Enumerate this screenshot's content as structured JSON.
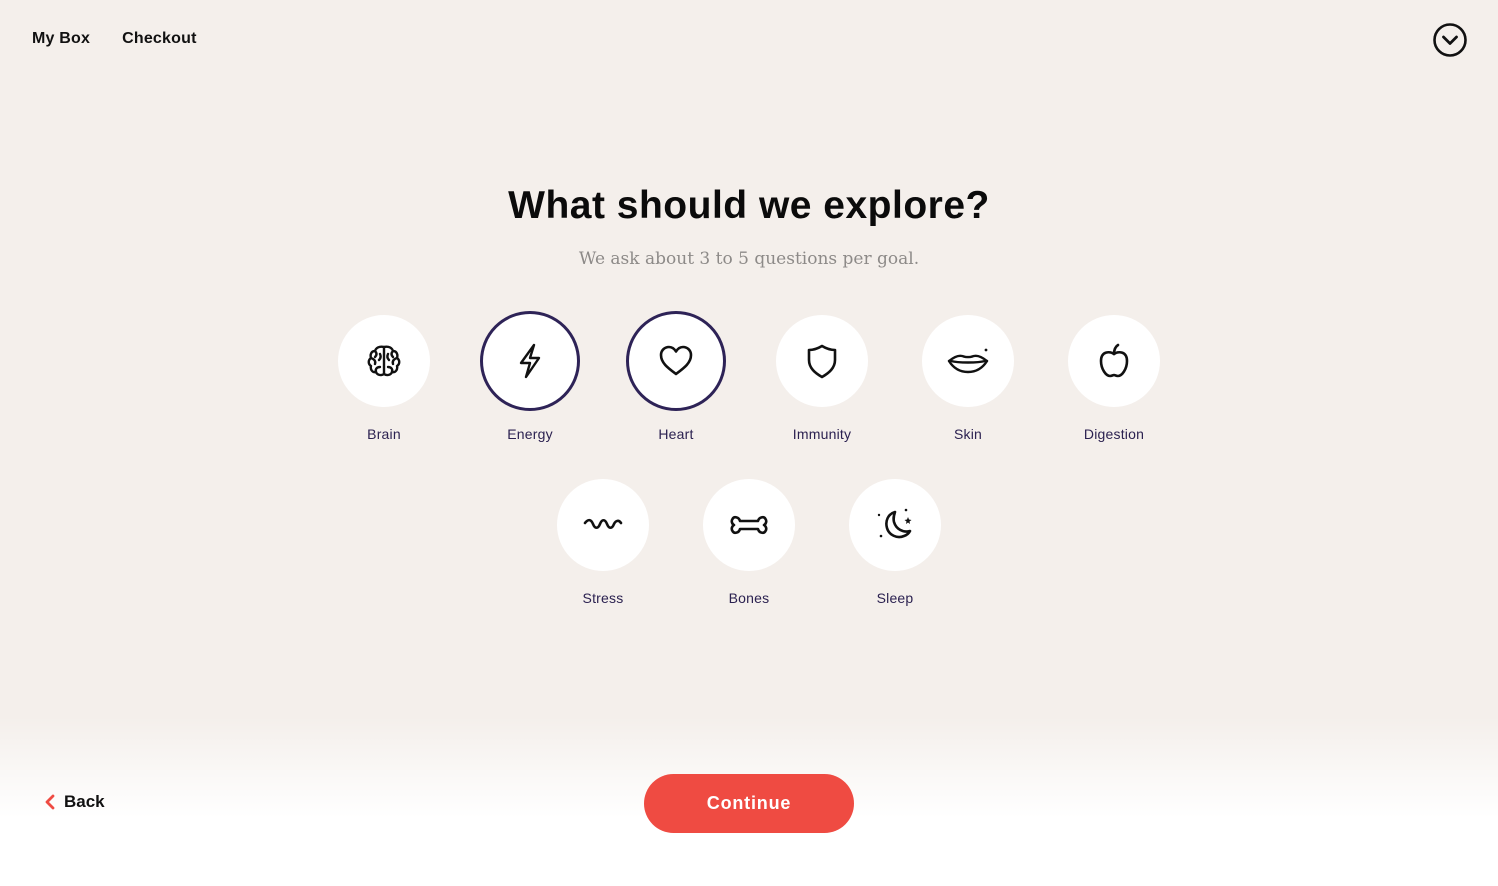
{
  "nav": {
    "items": [
      {
        "label": "My Box"
      },
      {
        "label": "Checkout"
      }
    ],
    "menu_icon": "chevron-down-circle-icon"
  },
  "main": {
    "title": "What should we explore?",
    "subtitle": "We ask about 3 to 5 questions per goal."
  },
  "goals": [
    {
      "label": "Brain",
      "icon": "brain-icon",
      "selected": false
    },
    {
      "label": "Energy",
      "icon": "lightning-icon",
      "selected": true
    },
    {
      "label": "Heart",
      "icon": "heart-icon",
      "selected": true
    },
    {
      "label": "Immunity",
      "icon": "shield-icon",
      "selected": false
    },
    {
      "label": "Skin",
      "icon": "lips-icon",
      "selected": false
    },
    {
      "label": "Digestion",
      "icon": "apple-icon",
      "selected": false
    },
    {
      "label": "Stress",
      "icon": "wave-icon",
      "selected": false
    },
    {
      "label": "Bones",
      "icon": "bone-icon",
      "selected": false
    },
    {
      "label": "Sleep",
      "icon": "moon-icon",
      "selected": false
    }
  ],
  "footer": {
    "back_label": "Back",
    "continue_label": "Continue"
  },
  "colors": {
    "background": "#f4efeb",
    "accent": "#ef4b42",
    "selected_ring": "#2e2357",
    "label_text": "#2b2150"
  }
}
